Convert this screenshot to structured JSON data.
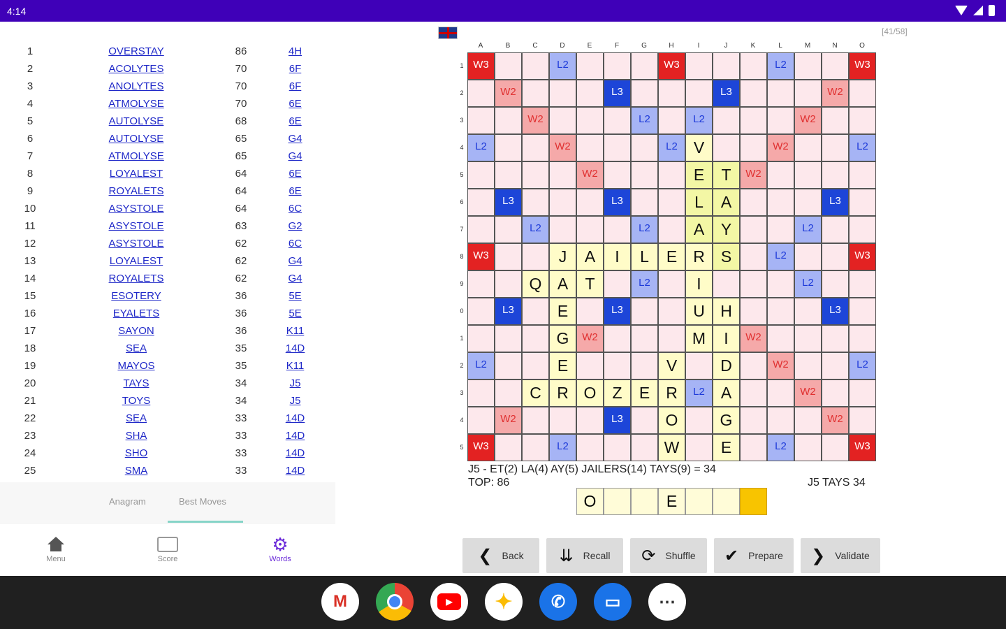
{
  "status_bar": {
    "time": "4:14"
  },
  "moves": [
    {
      "n": "1",
      "word": "OVERSTAY",
      "score": "86",
      "pos": "4H"
    },
    {
      "n": "2",
      "word": "ACOLYTES",
      "score": "70",
      "pos": "6F"
    },
    {
      "n": "3",
      "word": "ANOLYTES",
      "score": "70",
      "pos": "6F"
    },
    {
      "n": "4",
      "word": "ATMOLYSE",
      "score": "70",
      "pos": "6E"
    },
    {
      "n": "5",
      "word": "AUTOLYSE",
      "score": "68",
      "pos": "6E"
    },
    {
      "n": "6",
      "word": "AUTOLYSE",
      "score": "65",
      "pos": "G4"
    },
    {
      "n": "7",
      "word": "ATMOLYSE",
      "score": "65",
      "pos": "G4"
    },
    {
      "n": "8",
      "word": "LOYALEST",
      "score": "64",
      "pos": "6E"
    },
    {
      "n": "9",
      "word": "ROYALETS",
      "score": "64",
      "pos": "6E"
    },
    {
      "n": "10",
      "word": "ASYSTOLE",
      "score": "64",
      "pos": "6C"
    },
    {
      "n": "11",
      "word": "ASYSTOLE",
      "score": "63",
      "pos": "G2"
    },
    {
      "n": "12",
      "word": "ASYSTOLE",
      "score": "62",
      "pos": "6C"
    },
    {
      "n": "13",
      "word": "LOYALEST",
      "score": "62",
      "pos": "G4"
    },
    {
      "n": "14",
      "word": "ROYALETS",
      "score": "62",
      "pos": "G4"
    },
    {
      "n": "15",
      "word": "ESOTERY",
      "score": "36",
      "pos": "5E"
    },
    {
      "n": "16",
      "word": "EYALETS",
      "score": "36",
      "pos": "5E"
    },
    {
      "n": "17",
      "word": "SAYON",
      "score": "36",
      "pos": "K11"
    },
    {
      "n": "18",
      "word": "SEA",
      "score": "35",
      "pos": "14D"
    },
    {
      "n": "19",
      "word": "MAYOS",
      "score": "35",
      "pos": "K11"
    },
    {
      "n": "20",
      "word": "TAYS",
      "score": "34",
      "pos": "J5"
    },
    {
      "n": "21",
      "word": "TOYS",
      "score": "34",
      "pos": "J5"
    },
    {
      "n": "22",
      "word": "SEA",
      "score": "33",
      "pos": "14D"
    },
    {
      "n": "23",
      "word": "SHA",
      "score": "33",
      "pos": "14D"
    },
    {
      "n": "24",
      "word": "SHO",
      "score": "33",
      "pos": "14D"
    },
    {
      "n": "25",
      "word": "SMA",
      "score": "33",
      "pos": "14D"
    }
  ],
  "left_tabs": {
    "anagram": "Anagram",
    "best_moves": "Best Moves"
  },
  "bottom_nav": {
    "menu": "Menu",
    "score": "Score",
    "words": "Words"
  },
  "counter": "[41/58]",
  "board": {
    "columns": [
      "A",
      "B",
      "C",
      "D",
      "E",
      "F",
      "G",
      "H",
      "I",
      "J",
      "K",
      "L",
      "M",
      "N",
      "O"
    ],
    "row_labels": [
      "1",
      "2",
      "3",
      "4",
      "5",
      "6",
      "7",
      "8",
      "9",
      "0",
      "1",
      "2",
      "3",
      "4",
      "5"
    ],
    "rows": [
      [
        "W3",
        "",
        "",
        "L2",
        "",
        "",
        "",
        "W3",
        "",
        "",
        "",
        "L2",
        "",
        "",
        "W3"
      ],
      [
        "",
        "W2",
        "",
        "",
        "",
        "L3",
        "",
        "",
        "",
        "L3",
        "",
        "",
        "",
        "W2",
        ""
      ],
      [
        "",
        "",
        "W2",
        "",
        "",
        "",
        "L2",
        "",
        "L2",
        "",
        "",
        "",
        "W2",
        "",
        ""
      ],
      [
        "L2",
        "",
        "",
        "W2",
        "",
        "",
        "",
        "L2",
        "V",
        "",
        "",
        "W2",
        "",
        "",
        "L2"
      ],
      [
        "",
        "",
        "",
        "",
        "W2",
        "",
        "",
        "",
        "E",
        "T",
        "W2",
        "",
        "",
        "",
        ""
      ],
      [
        "",
        "L3",
        "",
        "",
        "",
        "L3",
        "",
        "",
        "L",
        "A",
        "",
        "",
        "",
        "L3",
        ""
      ],
      [
        "",
        "",
        "L2",
        "",
        "",
        "",
        "L2",
        "",
        "A",
        "Y",
        "",
        "",
        "L2",
        "",
        ""
      ],
      [
        "W3",
        "",
        "",
        "J",
        "A",
        "I",
        "L",
        "E",
        "R",
        "S",
        "",
        "L2",
        "",
        "",
        "W3"
      ],
      [
        "",
        "",
        "Q",
        "A",
        "T",
        "",
        "L2",
        "",
        "I",
        "",
        "",
        "",
        "L2",
        "",
        ""
      ],
      [
        "",
        "L3",
        "",
        "E",
        "",
        "L3",
        "",
        "",
        "U",
        "H",
        "",
        "",
        "",
        "L3",
        ""
      ],
      [
        "",
        "",
        "",
        "G",
        "W2",
        "",
        "",
        "",
        "M",
        "I",
        "W2",
        "",
        "",
        "",
        ""
      ],
      [
        "L2",
        "",
        "",
        "E",
        "",
        "",
        "",
        "V",
        "",
        "D",
        "",
        "W2",
        "",
        "",
        "L2"
      ],
      [
        "",
        "",
        "C",
        "R",
        "O",
        "Z",
        "E",
        "R",
        "L2",
        "A",
        "",
        "",
        "W2",
        "",
        ""
      ],
      [
        "",
        "W2",
        "",
        "",
        "",
        "L3",
        "",
        "O",
        "",
        "G",
        "",
        "",
        "",
        "W2",
        ""
      ],
      [
        "W3",
        "",
        "",
        "L2",
        "",
        "",
        "",
        "W",
        "",
        "E",
        "",
        "L2",
        "",
        "",
        "W3"
      ]
    ]
  },
  "move_summary": "J5 - ET(2) LA(4) AY(5) JAILERS(14) TAYS(9) = 34",
  "top_label": "TOP: 86",
  "current_move": "J5 TAYS 34",
  "rack": [
    "O",
    "",
    "",
    "E",
    "",
    "",
    ""
  ],
  "buttons": {
    "back": "Back",
    "recall": "Recall",
    "shuffle": "Shuffle",
    "prepare": "Prepare",
    "validate": "Validate"
  },
  "dock_apps": [
    "gmail-icon",
    "chrome-icon",
    "youtube-icon",
    "photos-icon",
    "phone-icon",
    "messages-icon",
    "apps-icon"
  ]
}
